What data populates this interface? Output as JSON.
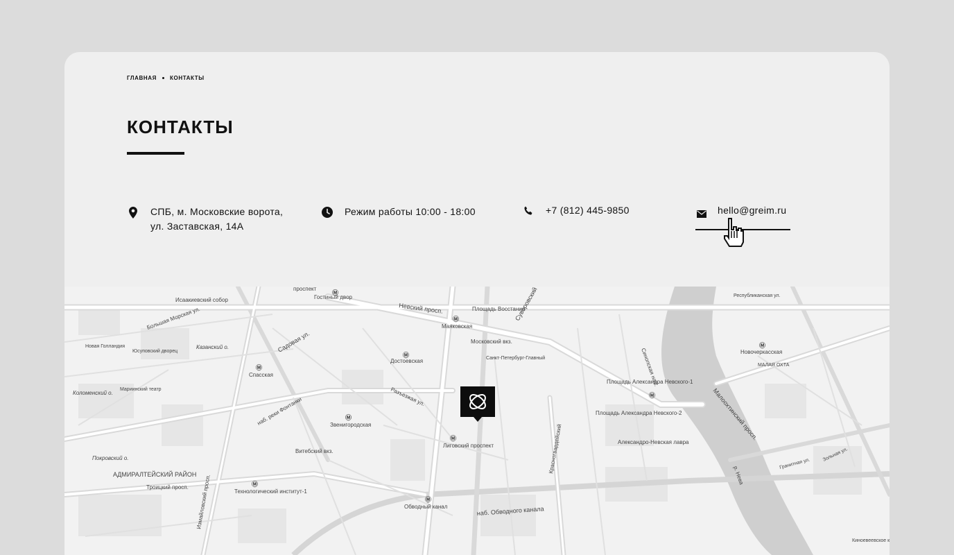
{
  "breadcrumb": {
    "home": "ГЛАВНАЯ",
    "current": "КОНТАКТЫ"
  },
  "page_title": "КОНТАКТЫ",
  "contacts": {
    "address_line1": "СПБ, м. Московские ворота,",
    "address_line2": "ул. Заставская, 14А",
    "hours": "Режим работы 10:00 - 18:00",
    "phone": "+7 (812) 445-9850",
    "email": "hello@greim.ru"
  },
  "icons": {
    "address": "map-pin-icon",
    "hours": "clock-icon",
    "phone": "phone-icon",
    "email": "envelope-icon",
    "cursor": "hand-pointer-icon",
    "marker": "company-logo-marker"
  },
  "map": {
    "labels": [
      "Невский просп.",
      "Гостиный двор",
      "Исаакиевский собор",
      "Большая Морская ул.",
      "Садовая ул.",
      "Спасская",
      "Достоевская",
      "Маяковская",
      "Площадь Восстания",
      "Московский вкз.",
      "Санкт-Петербург-Главный",
      "Суворовский",
      "Лиговский проспект",
      "Звенигородская",
      "Витебский вкз.",
      "Технологический институт-1",
      "Обводный канал",
      "наб. Обводного канала",
      "Площадь Александра Невского-1",
      "Площадь Александра Невского-2",
      "Александро-Невская лавра",
      "Новочеркасская",
      "МАЛАЯ ОХТА",
      "Малоохтинский просп.",
      "р. Нева",
      "АДМИРАЛТЕЙСКИЙ РАЙОН",
      "Новая Голландия",
      "Юсуповский дворец",
      "Мариинский театр",
      "Коломенский о.",
      "Покровский о.",
      "Казанский о.",
      "наб. реки Фонтанки",
      "Измайловский просп.",
      "Синопская наб.",
      "Республиканская ул.",
      "Троицкий просп.",
      "Красногвардейский",
      "Гранитная ул.",
      "Зольная ул.",
      "Киноевеевское кладбище",
      "проспект",
      "Невский просп.",
      "Разъезжая ул.",
      "Лиговский просп."
    ]
  }
}
